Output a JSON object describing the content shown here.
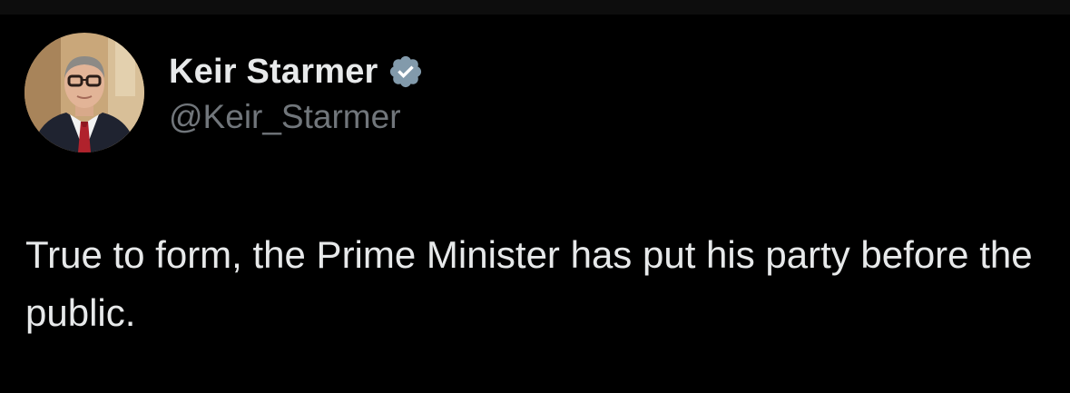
{
  "tweet": {
    "author": {
      "display_name": "Keir Starmer",
      "handle": "@Keir_Starmer",
      "verified": true,
      "avatar_icon": "profile-photo"
    },
    "text": "True to form, the Prime Minister has put his party before the public."
  },
  "colors": {
    "background": "#000000",
    "primary_text": "#e7e9ea",
    "secondary_text": "#71767b",
    "verified_badge": "#829aab"
  }
}
